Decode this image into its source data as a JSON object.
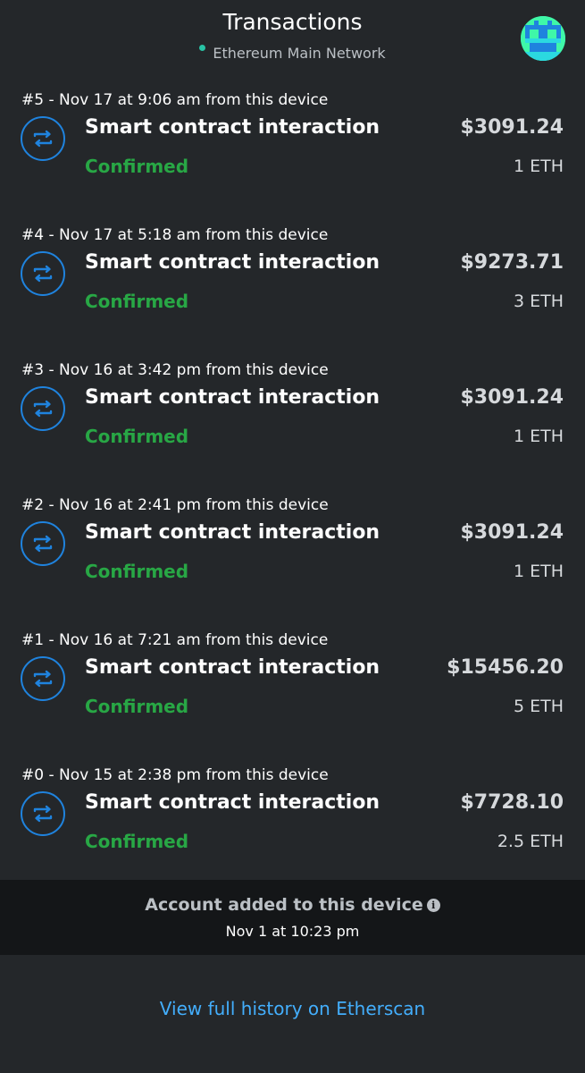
{
  "header": {
    "title": "Transactions",
    "network": "Ethereum Main Network",
    "network_dot_color": "#28c3a5",
    "avatar_icon": "identicon-avatar"
  },
  "transactions": [
    {
      "meta": "#5 - Nov 17 at 9:06 am from this device",
      "title": "Smart contract interaction",
      "status": "Confirmed",
      "fiat": "$3091.24",
      "eth": "1 ETH",
      "icon": "swap-arrows-icon"
    },
    {
      "meta": "#4 - Nov 17 at 5:18 am from this device",
      "title": "Smart contract interaction",
      "status": "Confirmed",
      "fiat": "$9273.71",
      "eth": "3 ETH",
      "icon": "swap-arrows-icon"
    },
    {
      "meta": "#3 - Nov 16 at 3:42 pm from this device",
      "title": "Smart contract interaction",
      "status": "Confirmed",
      "fiat": "$3091.24",
      "eth": "1 ETH",
      "icon": "swap-arrows-icon"
    },
    {
      "meta": "#2 - Nov 16 at 2:41 pm from this device",
      "title": "Smart contract interaction",
      "status": "Confirmed",
      "fiat": "$3091.24",
      "eth": "1 ETH",
      "icon": "swap-arrows-icon"
    },
    {
      "meta": "#1 - Nov 16 at 7:21 am from this device",
      "title": "Smart contract interaction",
      "status": "Confirmed",
      "fiat": "$15456.20",
      "eth": "5 ETH",
      "icon": "swap-arrows-icon"
    },
    {
      "meta": "#0 - Nov 15 at 2:38 pm from this device",
      "title": "Smart contract interaction",
      "status": "Confirmed",
      "fiat": "$7728.10",
      "eth": "2.5 ETH",
      "icon": "swap-arrows-icon"
    }
  ],
  "account": {
    "title": "Account added to this device",
    "info_icon": "i",
    "date": "Nov 1 at 10:23 pm"
  },
  "footer": {
    "etherscan_link": "View full history on Etherscan"
  },
  "colors": {
    "background": "#24272a",
    "confirmed": "#28a745",
    "link": "#43aefc",
    "icon_blue": "#1f83de"
  }
}
